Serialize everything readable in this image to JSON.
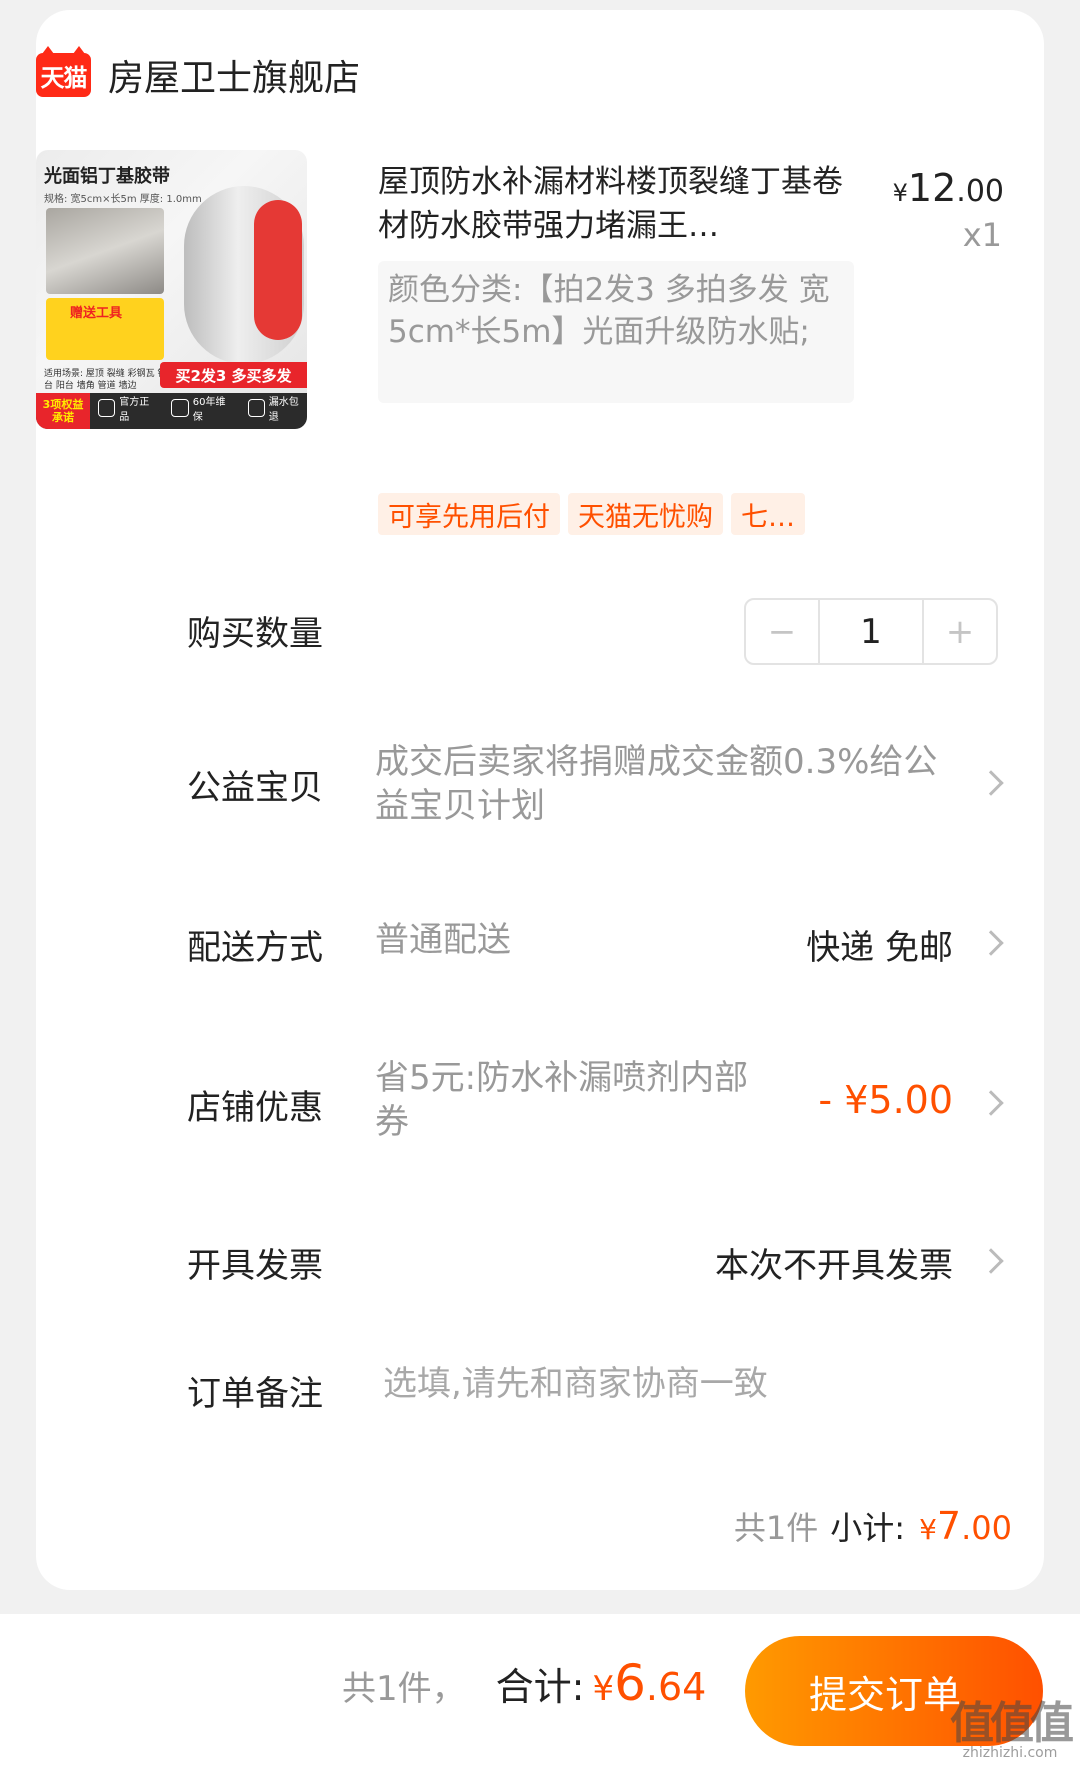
{
  "store": {
    "logo_text": "天猫",
    "name": "房屋卫士旗舰店"
  },
  "product": {
    "image": {
      "title": "光面铝丁基胶带",
      "spec": "规格: 宽5cm×长5m  厚度: 1.0mm",
      "gift": "赠送工具",
      "usage": "适用场景: 屋顶 裂缝 彩钢瓦 铁皮 窗台 阳台 墙角 管道 墙边",
      "promo": "买2发3 多买多发",
      "pledge": "3项权益承诺",
      "badges": [
        "官方正品",
        "60年维保",
        "漏水包退"
      ]
    },
    "title": "屋顶防水补漏材料楼顶裂缝丁基卷材防水胶带强力堵漏王…",
    "price": {
      "currency": "¥",
      "integer": "12",
      "decimal": ".00"
    },
    "quantity_label": "x1",
    "sku": "颜色分类:【拍2发3 多拍多发 宽5cm*长5m】光面升级防水贴;",
    "tags": [
      "可享先用后付",
      "天猫无忧购",
      "七…"
    ]
  },
  "rows": {
    "quantity": {
      "label": "购买数量",
      "minus": "−",
      "value": "1",
      "plus": "+"
    },
    "charity": {
      "label": "公益宝贝",
      "value": "成交后卖家将捐赠成交金额0.3%给公益宝贝计划"
    },
    "delivery": {
      "label": "配送方式",
      "value": "普通配送",
      "right": "快递 免邮"
    },
    "coupon": {
      "label": "店铺优惠",
      "value": "省5元:防水补漏喷剂内部券",
      "amount": "- ¥5.00"
    },
    "invoice": {
      "label": "开具发票",
      "value": "本次不开具发票"
    },
    "remark": {
      "label": "订单备注",
      "placeholder": "选填,请先和商家协商一致"
    }
  },
  "subtotal": {
    "count": "共1件",
    "label": "小计:",
    "currency": "¥",
    "integer": "7",
    "decimal": ".00"
  },
  "footer": {
    "count": "共1件，",
    "label": "合计:",
    "currency": "¥",
    "integer": "6",
    "decimal": ".64",
    "submit": "提交订单"
  },
  "watermark": {
    "logo": "值值值",
    "url": "zhizhizhi.com"
  },
  "colors": {
    "accent": "#ff5000",
    "tmall_red": "#ff2a16",
    "button_start": "#ff9a00"
  }
}
